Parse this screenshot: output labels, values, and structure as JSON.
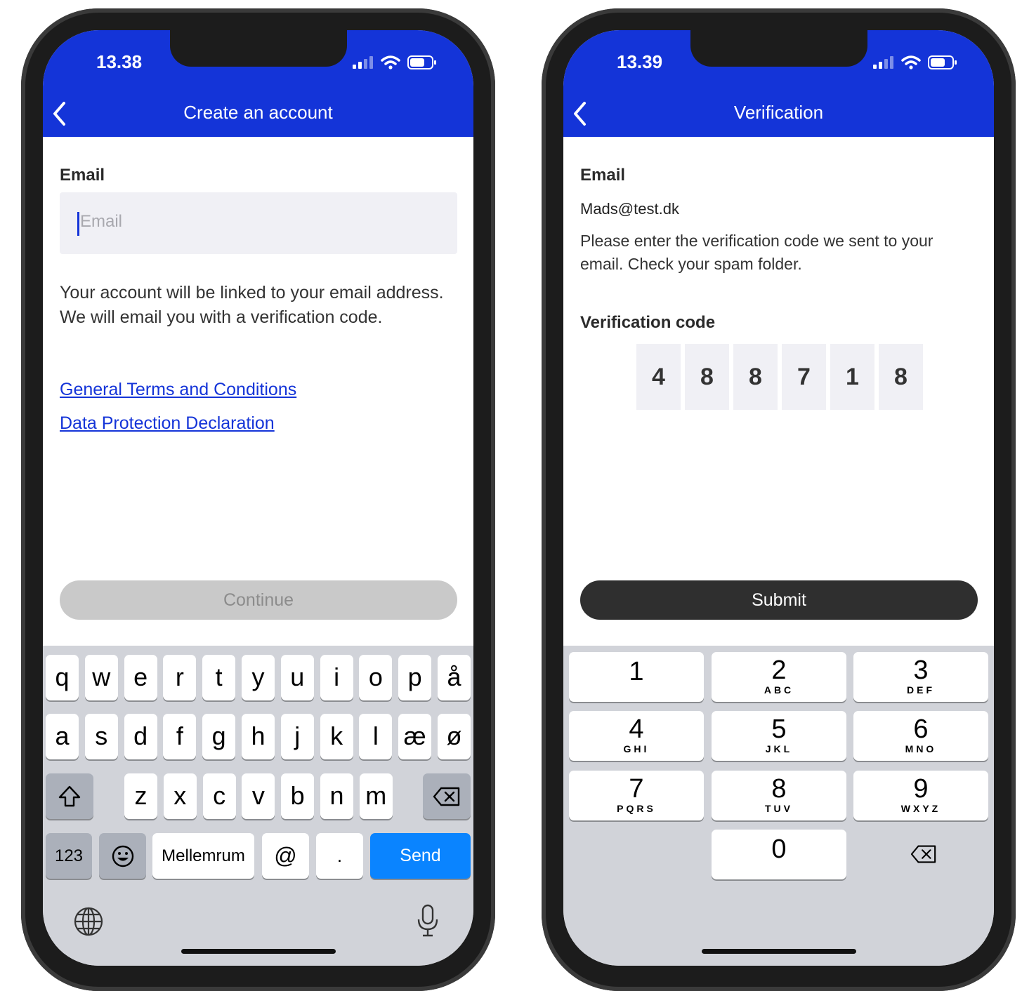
{
  "colors": {
    "brand": "#1434d8",
    "send": "#0a84ff",
    "submit": "#2f2f2f"
  },
  "left": {
    "status_time": "13.38",
    "title": "Create an account",
    "email_label": "Email",
    "email_placeholder": "Email",
    "info": "Your account will be linked to your email address. We will email you with a verification code.",
    "terms_link": "General Terms and Conditions",
    "privacy_link": "Data Protection Declaration",
    "continue_label": "Continue",
    "keyboard": {
      "row1": [
        "q",
        "w",
        "e",
        "r",
        "t",
        "y",
        "u",
        "i",
        "o",
        "p",
        "å"
      ],
      "row2": [
        "a",
        "s",
        "d",
        "f",
        "g",
        "h",
        "j",
        "k",
        "l",
        "æ",
        "ø"
      ],
      "row3": [
        "z",
        "x",
        "c",
        "v",
        "b",
        "n",
        "m"
      ],
      "num_key": "123",
      "space": "Mellemrum",
      "at": "@",
      "dot": ".",
      "send": "Send"
    }
  },
  "right": {
    "status_time": "13.39",
    "title": "Verification",
    "email_label": "Email",
    "email_value": "Mads@test.dk",
    "instruction": "Please enter the verification code we sent to your email. Check your spam folder.",
    "code_label": "Verification code",
    "code": [
      "4",
      "8",
      "8",
      "7",
      "1",
      "8"
    ],
    "submit_label": "Submit",
    "numpad": [
      {
        "digit": "1",
        "letters": ""
      },
      {
        "digit": "2",
        "letters": "ABC"
      },
      {
        "digit": "3",
        "letters": "DEF"
      },
      {
        "digit": "4",
        "letters": "GHI"
      },
      {
        "digit": "5",
        "letters": "JKL"
      },
      {
        "digit": "6",
        "letters": "MNO"
      },
      {
        "digit": "7",
        "letters": "PQRS"
      },
      {
        "digit": "8",
        "letters": "TUV"
      },
      {
        "digit": "9",
        "letters": "WXYZ"
      },
      {
        "digit": "0",
        "letters": ""
      }
    ]
  }
}
